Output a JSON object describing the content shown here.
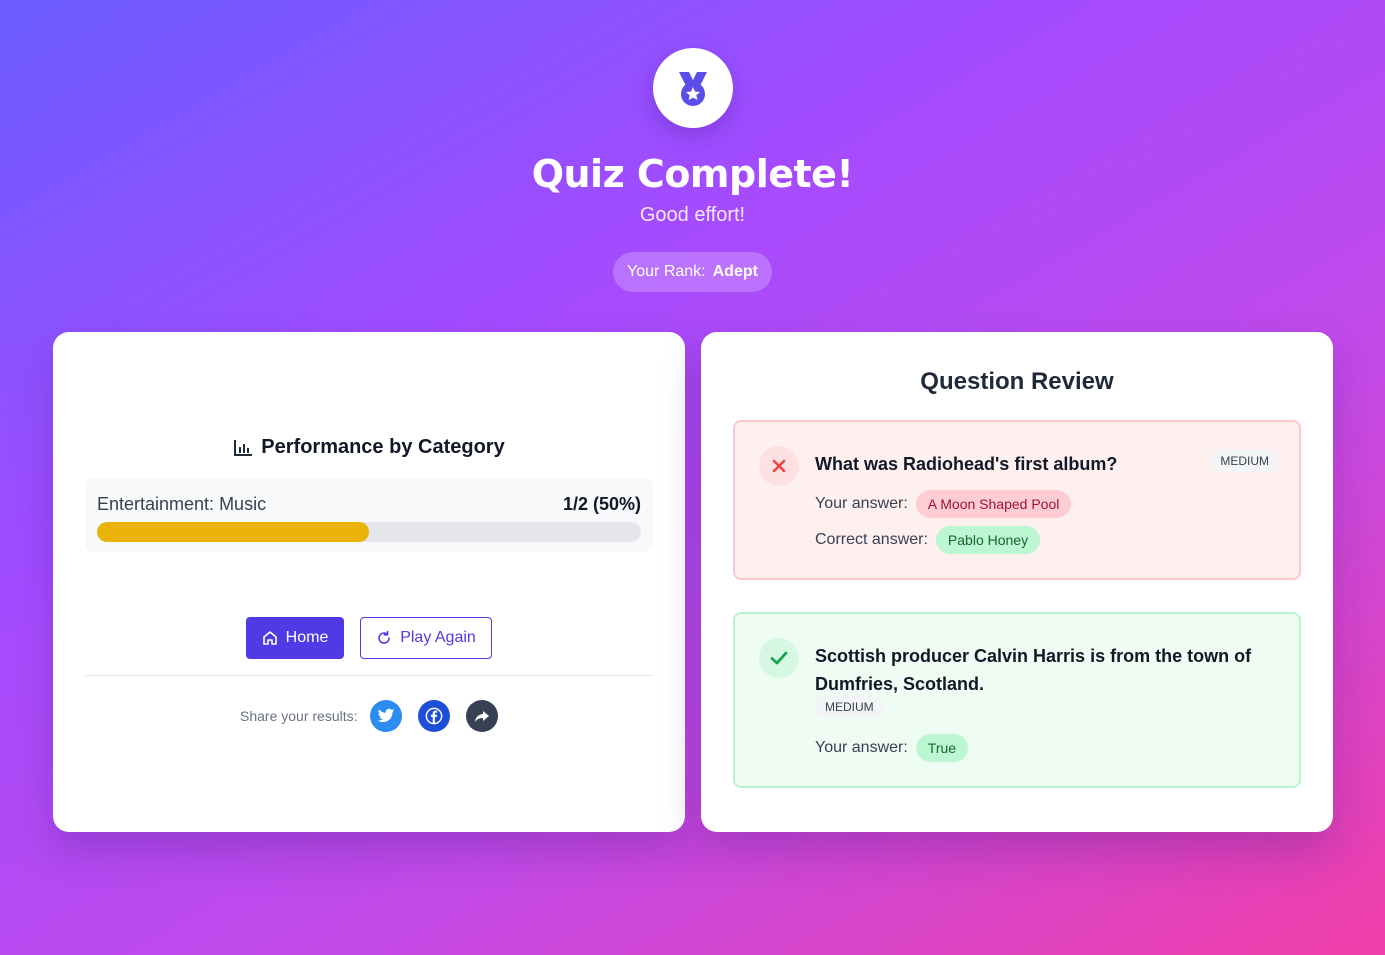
{
  "hero": {
    "icon": "medal-icon",
    "title": "Quiz Complete!",
    "subtitle": "Good effort!",
    "rank_label": "Your Rank:",
    "rank_value": "Adept"
  },
  "performance": {
    "icon": "bar-chart-icon",
    "title": "Performance by Category",
    "categories": [
      {
        "name": "Entertainment: Music",
        "score": "1/2 (50%)",
        "progress": 0.5,
        "bar_color": "#eab308"
      }
    ]
  },
  "actions": {
    "home_label": "Home",
    "play_again_label": "Play Again"
  },
  "share": {
    "label": "Share your results:",
    "buttons": [
      "twitter-icon",
      "facebook-icon",
      "share-icon"
    ]
  },
  "review": {
    "title": "Question Review",
    "questions": [
      {
        "status": "incorrect",
        "question": "What was Radiohead's first album?",
        "difficulty": "MEDIUM",
        "your_answer_label": "Your answer:",
        "your_answer": "A Moon Shaped Pool",
        "correct_answer_label": "Correct answer:",
        "correct_answer": "Pablo Honey"
      },
      {
        "status": "correct",
        "question": "Scottish producer Calvin Harris is from the town of Dumfries, Scotland.",
        "difficulty": "MEDIUM",
        "your_answer_label": "Your answer:",
        "your_answer": "True"
      }
    ]
  },
  "colors": {
    "accent": "#4f3ae6",
    "incorrect": "#ef4444",
    "correct": "#16a34a"
  }
}
